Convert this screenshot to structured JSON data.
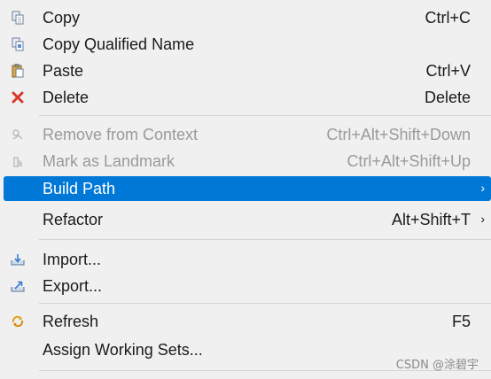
{
  "menu": {
    "items": [
      {
        "label": "Copy",
        "shortcut": "Ctrl+C",
        "icon": "copy-icon"
      },
      {
        "label": "Copy Qualified Name",
        "shortcut": "",
        "icon": "copy-qualified-name-icon"
      },
      {
        "label": "Paste",
        "shortcut": "Ctrl+V",
        "icon": "paste-icon"
      },
      {
        "label": "Delete",
        "shortcut": "Delete",
        "icon": "delete-icon"
      },
      {
        "label": "Remove from Context",
        "shortcut": "Ctrl+Alt+Shift+Down",
        "icon": "remove-from-context-icon",
        "disabled": true
      },
      {
        "label": "Mark as Landmark",
        "shortcut": "Ctrl+Alt+Shift+Up",
        "icon": "landmark-icon",
        "disabled": true
      },
      {
        "label": "Build Path",
        "shortcut": "",
        "submenu": true,
        "highlighted": true
      },
      {
        "label": "Refactor",
        "shortcut": "Alt+Shift+T",
        "submenu": true
      },
      {
        "label": "Import...",
        "shortcut": "",
        "icon": "import-icon"
      },
      {
        "label": "Export...",
        "shortcut": "",
        "icon": "export-icon"
      },
      {
        "label": "Refresh",
        "shortcut": "F5",
        "icon": "refresh-icon"
      },
      {
        "label": "Assign Working Sets...",
        "shortcut": ""
      }
    ],
    "submenu_arrow": "›"
  },
  "watermark": "CSDN @涂碧宇",
  "colors": {
    "background": "#f0f0f0",
    "highlight": "#0078d7",
    "disabled_text": "#9a9a9a",
    "separator": "#d4d4d4",
    "delete_red": "#d9382c"
  }
}
